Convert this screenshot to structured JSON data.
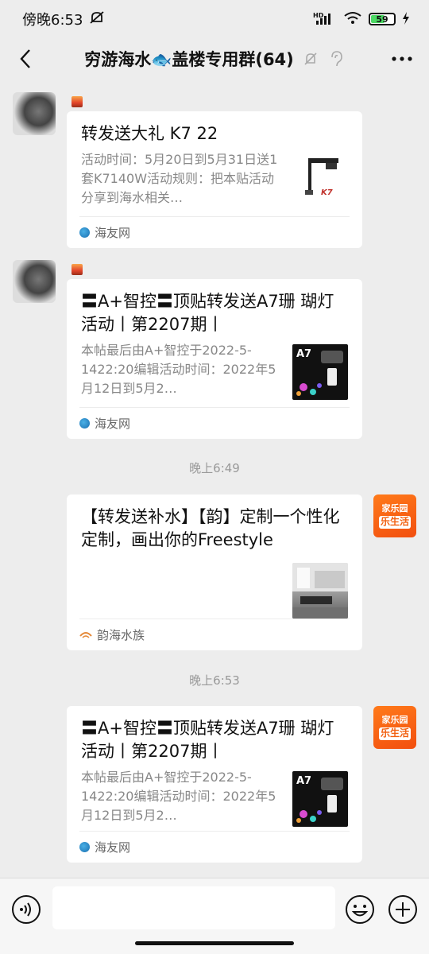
{
  "status_bar": {
    "time": "傍晚6:53",
    "network": "HD",
    "battery": "59"
  },
  "header": {
    "title": "穷游海水🐟盖楼专用群(64)"
  },
  "messages": [
    {
      "title": "转发送大礼 K7 22",
      "desc": "活动时间：5月20日到5月31日送1套K7140W活动规则：把本贴活动分享到海水相关…",
      "source": "海友网",
      "thumb_label": "K7"
    },
    {
      "title": "〓A+智控〓顶贴转发送A7珊 瑚灯活动丨第2207期丨",
      "desc": "本帖最后由A+智控于2022-5-1422:20编辑活动时间：2022年5月12日到5月2…",
      "source": "海友网",
      "thumb_label": "A7"
    },
    {
      "title": "【转发送补水】【韵】定制一个性化定制，画出你的Freestyle",
      "desc": "",
      "source": "韵海水族"
    },
    {
      "title": "〓A+智控〓顶贴转发送A7珊 瑚灯活动丨第2207期丨",
      "desc": "本帖最后由A+智控于2022-5-1422:20编辑活动时间：2022年5月12日到5月2…",
      "source": "海友网",
      "thumb_label": "A7"
    }
  ],
  "timestamps": [
    "晚上6:49",
    "晚上6:53"
  ],
  "shop_avatar": {
    "line1": "家乐园",
    "line2": "乐生活"
  },
  "colors": {
    "background": "#ededed",
    "card": "#ffffff",
    "shop_orange": "#f26010"
  }
}
